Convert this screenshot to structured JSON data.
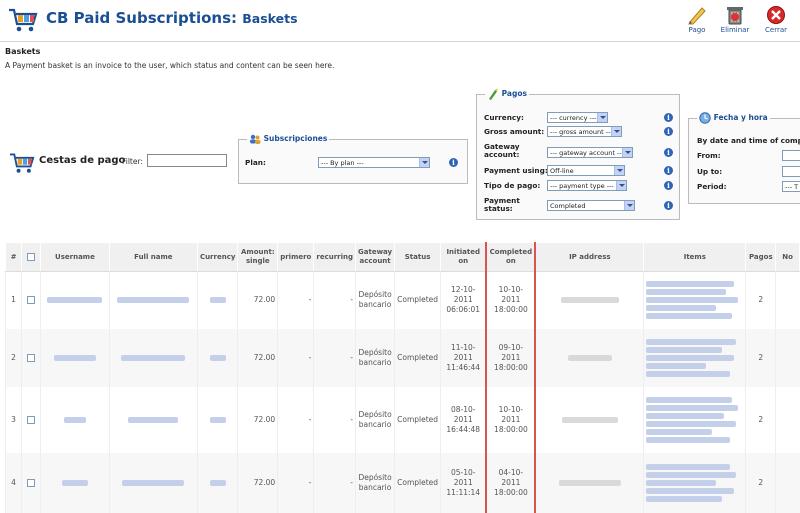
{
  "header": {
    "title": "CB Paid Subscriptions:",
    "subtitle": "Baskets",
    "toolbar": [
      {
        "label": "Pago",
        "icon": "pencil-icon"
      },
      {
        "label": "Eliminar",
        "icon": "trash-icon"
      },
      {
        "label": "Cerrar",
        "icon": "close-icon"
      }
    ]
  },
  "page": {
    "heading": "Baskets",
    "description": "A Payment basket is an invoice to the user, which status and content can be seen here."
  },
  "filter": {
    "title": "Cestas de pago",
    "label": "Filter:",
    "value": ""
  },
  "subscripciones": {
    "legend": "Subscripciones",
    "plan_label": "Plan:",
    "plan_value": "--- By plan ---"
  },
  "pagos": {
    "legend": "Pagos",
    "fields": [
      {
        "label": "Currency:",
        "value": "--- currency ---"
      },
      {
        "label": "Gross amount:",
        "value": "--- gross amount ---"
      },
      {
        "label": "Gateway account:",
        "value": "--- gateway account ---"
      },
      {
        "label": "Payment using:",
        "value": "Off-line"
      },
      {
        "label": "Tipo de pago:",
        "value": "--- payment type ---"
      },
      {
        "label": "Payment status:",
        "value": "Completed"
      }
    ]
  },
  "fecha": {
    "legend": "Fecha y hora",
    "intro": "By date and time of complet",
    "fields": [
      {
        "label": "From:"
      },
      {
        "label": "Up to:"
      },
      {
        "label": "Period:",
        "value": "--- T"
      }
    ]
  },
  "table": {
    "columns": [
      "#",
      "Username",
      "Full name",
      "Currency",
      "Amount: single",
      "primero",
      "recurring",
      "Gateway account",
      "Status",
      "Initiated on",
      "Completed on",
      "IP address",
      "Items",
      "Pagos",
      "No"
    ],
    "rows": [
      {
        "num": "1",
        "amount": "72.00",
        "primero": "-",
        "recurring": "-",
        "gateway": "Depósito bancario",
        "status": "Completed",
        "initiated": "12-10-2011 06:06:01",
        "completed": "10-10-2011 18:00:00",
        "pagos": "2"
      },
      {
        "num": "2",
        "amount": "72.00",
        "primero": "-",
        "recurring": "-",
        "gateway": "Depósito bancario",
        "status": "Completed",
        "initiated": "11-10-2011 11:46:44",
        "completed": "09-10-2011 18:00:00",
        "pagos": "2"
      },
      {
        "num": "3",
        "amount": "72.00",
        "primero": "-",
        "recurring": "-",
        "gateway": "Depósito bancario",
        "status": "Completed",
        "initiated": "08-10-2011 16:44:48",
        "completed": "10-10-2011 18:00:00",
        "pagos": "2"
      },
      {
        "num": "4",
        "amount": "72.00",
        "primero": "-",
        "recurring": "-",
        "gateway": "Depósito bancario",
        "status": "Completed",
        "initiated": "05-10-2011 11:11:14",
        "completed": "04-10-2011 18:00:00",
        "pagos": "2"
      }
    ]
  },
  "colors": {
    "brand": "#1b4f93",
    "highlight": "#d9534f"
  }
}
